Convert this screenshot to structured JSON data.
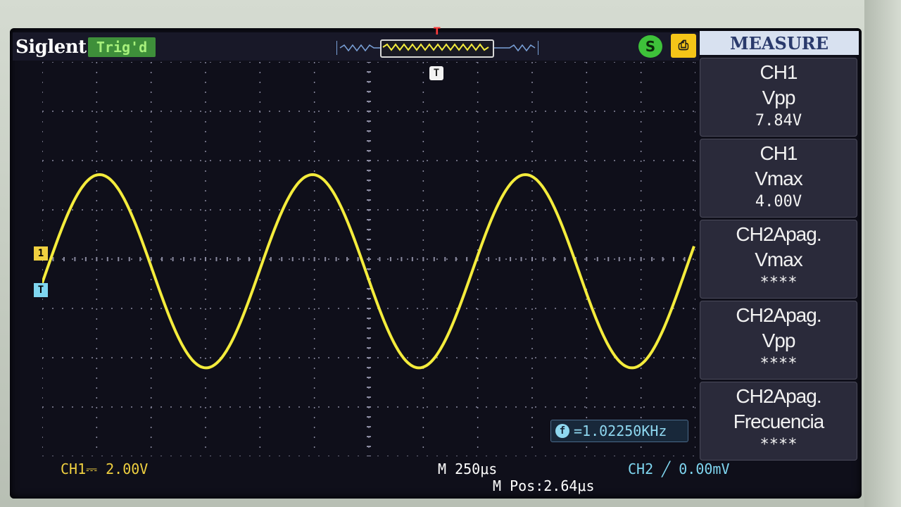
{
  "header": {
    "brand": "Siglent",
    "trigger_status": "Trig'd",
    "trigger_marker": "T"
  },
  "measure_menu": {
    "title": "MEASURE",
    "items": [
      {
        "source": "CH1",
        "type": "Vpp",
        "value": "7.84V"
      },
      {
        "source": "CH1",
        "type": "Vmax",
        "value": "4.00V"
      },
      {
        "source": "CH2Apag.",
        "type": "Vmax",
        "value": "****"
      },
      {
        "source": "CH2Apag.",
        "type": "Vpp",
        "value": "****"
      },
      {
        "source": "CH2Apag.",
        "type": "Frecuencia",
        "value": "****"
      }
    ]
  },
  "markers": {
    "ch1": "1",
    "trigger_level": "T"
  },
  "frequency_counter": {
    "icon": "f-icon",
    "value": "=1.02250KHz"
  },
  "status": {
    "ch1_scale": "CH1⎓ 2.00V",
    "timebase": "M 250μs",
    "ch2_trigger": "CH2 ╱ 0.00mV",
    "position": "M Pos:2.64μs"
  },
  "colors": {
    "ch1_trace": "#f4ec3c",
    "ch1_label": "#f0d040",
    "ch2_label": "#7fd6f0",
    "grid": "#8a8aa0"
  },
  "waveform": {
    "channel": "CH1",
    "shape": "sine",
    "vpp": 7.84,
    "vmax": 4.0,
    "frequency_khz": 1.0225,
    "volts_per_div": 2.0,
    "time_per_div_us": 250
  }
}
